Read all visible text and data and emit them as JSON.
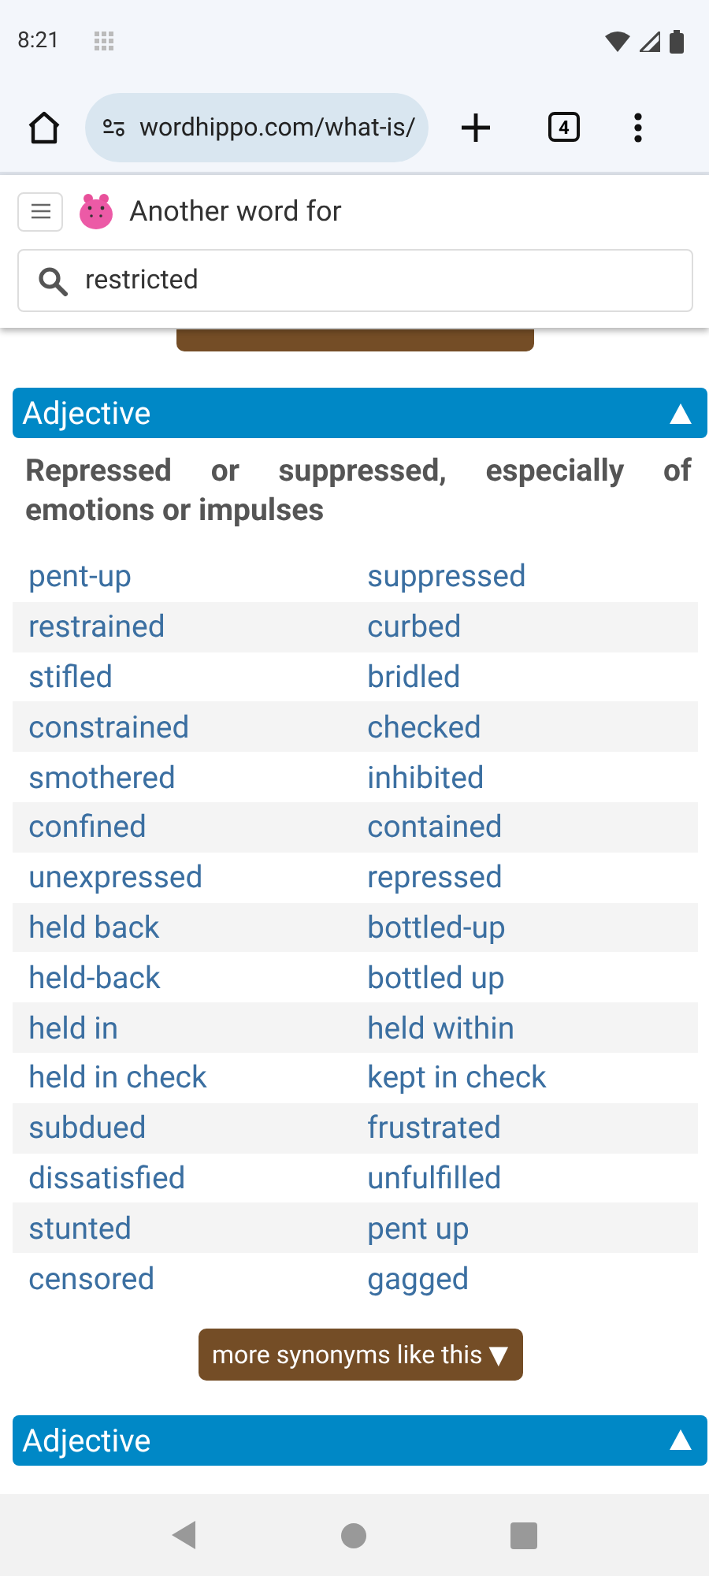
{
  "status_bar": {
    "time": "8:21"
  },
  "browser": {
    "url": "wordhippo.com/what-is/",
    "tab_count": "4"
  },
  "header": {
    "title": "Another word for",
    "search": {
      "value": "restricted"
    }
  },
  "sections": [
    {
      "heading": "Adjective",
      "expanded": true,
      "definition": "Repressed or suppressed, especially of emotions or impulses",
      "rows": [
        [
          "pent-up",
          "suppressed"
        ],
        [
          "restrained",
          "curbed"
        ],
        [
          "stifled",
          "bridled"
        ],
        [
          "constrained",
          "checked"
        ],
        [
          "smothered",
          "inhibited"
        ],
        [
          "confined",
          "contained"
        ],
        [
          "unexpressed",
          "repressed"
        ],
        [
          "held back",
          "bottled-up"
        ],
        [
          "held-back",
          "bottled up"
        ],
        [
          "held in",
          "held within"
        ],
        [
          "held in check",
          "kept in check"
        ],
        [
          "subdued",
          "frustrated"
        ],
        [
          "dissatisfied",
          "unfulfilled"
        ],
        [
          "stunted",
          "pent up"
        ],
        [
          "censored",
          "gagged"
        ]
      ],
      "more_button": "more synonyms like this ▼"
    },
    {
      "heading": "Adjective",
      "expanded": true
    }
  ]
}
